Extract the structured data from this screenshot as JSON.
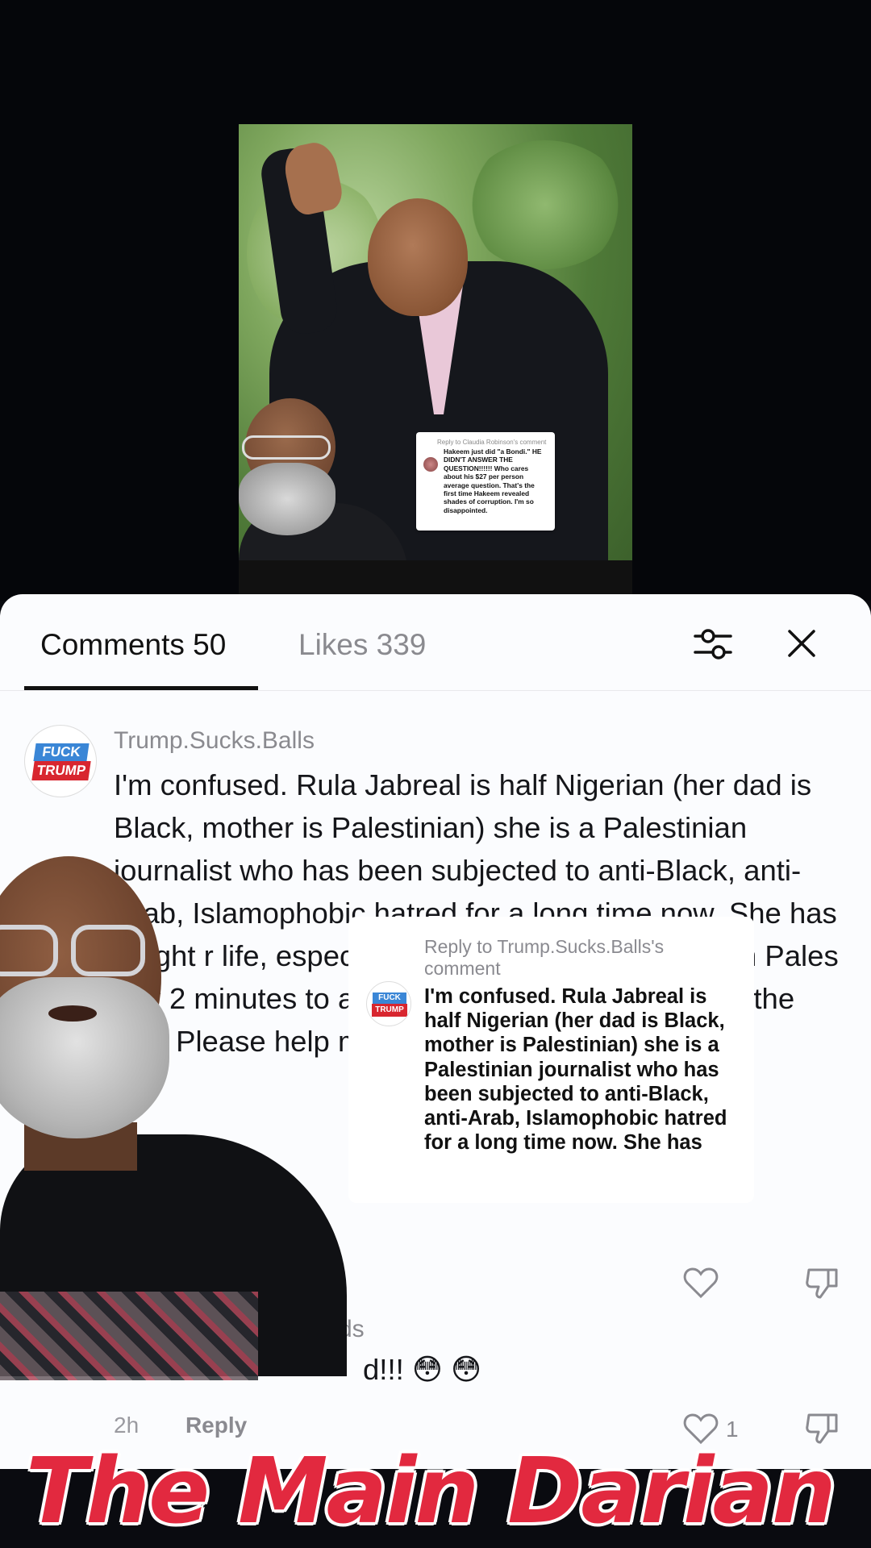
{
  "video": {
    "reply_sticker": {
      "title": "Reply to Claudia Robinson's comment",
      "text": "Hakeem just did \"a Bondi.\" HE DIDN'T ANSWER THE QUESTION!!!!!! Who cares about his $27 per person average question. That's the first time Hakeem revealed shades of corruption. I'm so disappointed."
    }
  },
  "tabs": {
    "comments": "Comments 50",
    "likes": "Likes 339"
  },
  "comments": [
    {
      "username": "Trump.Sucks.Balls",
      "avatar_top": "FUCK",
      "avatar_bottom": "TRUMP",
      "text": "I'm confused. Rula Jabreal is half Nigerian (her dad is Black, mother is Palestinian) she is a Palestinian journalist who has been subjected to anti-Black, anti-Arab, Islamophobic hatred for a long time now. She has fought r                                     life, especially from w                                    hole family living in Pales                                     ook 2 minutes to ap                                       t ant, and now                                         an and Sc                                          ng the line. Please help me understand."
    },
    {
      "username_partial": "ds",
      "text_partial": "d!!! 😳 😳",
      "time": "2h",
      "reply": "Reply",
      "like_count": "1"
    }
  ],
  "reply_overlay": {
    "header": "Reply to Trump.Sucks.Balls's comment",
    "avatar_top": "FUCK",
    "avatar_bottom": "TRUMP",
    "text": "I'm confused. Rula Jabreal is half Nigerian (her dad is Black, mother is Palestinian) she is a Palestinian journalist who has been subjected to anti-Black, anti-Arab, Islamophobic hatred for a long time now. She has"
  },
  "banner": {
    "text": "The Main Darian",
    "color": "#e2293f"
  }
}
